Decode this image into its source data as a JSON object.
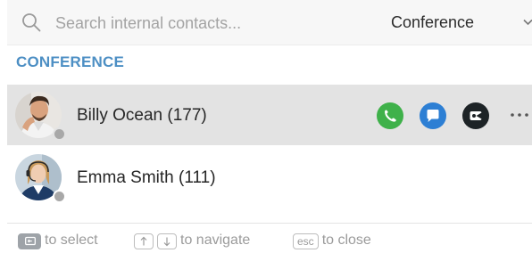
{
  "search": {
    "placeholder": "Search internal contacts...",
    "value": ""
  },
  "filter": {
    "selected": "Conference",
    "icon": "chevron-down-icon"
  },
  "section": {
    "title": "CONFERENCE"
  },
  "contacts": [
    {
      "name": "Billy Ocean (177)",
      "presence": "offline",
      "highlighted": true,
      "actions": {
        "call": "phone-icon",
        "chat": "chat-icon",
        "video": "video-icon",
        "more": "more-icon"
      }
    },
    {
      "name": "Emma Smith (111)",
      "presence": "offline",
      "highlighted": false
    }
  ],
  "footer": {
    "select_text": "to select",
    "navigate_text": "to navigate",
    "close_key": "esc",
    "close_text": "to close"
  },
  "colors": {
    "section_header": "#4d8fc4",
    "call": "#3fb14a",
    "chat": "#2d7fd4",
    "video": "#1d2326",
    "row_highlight": "#e3e3e3"
  }
}
